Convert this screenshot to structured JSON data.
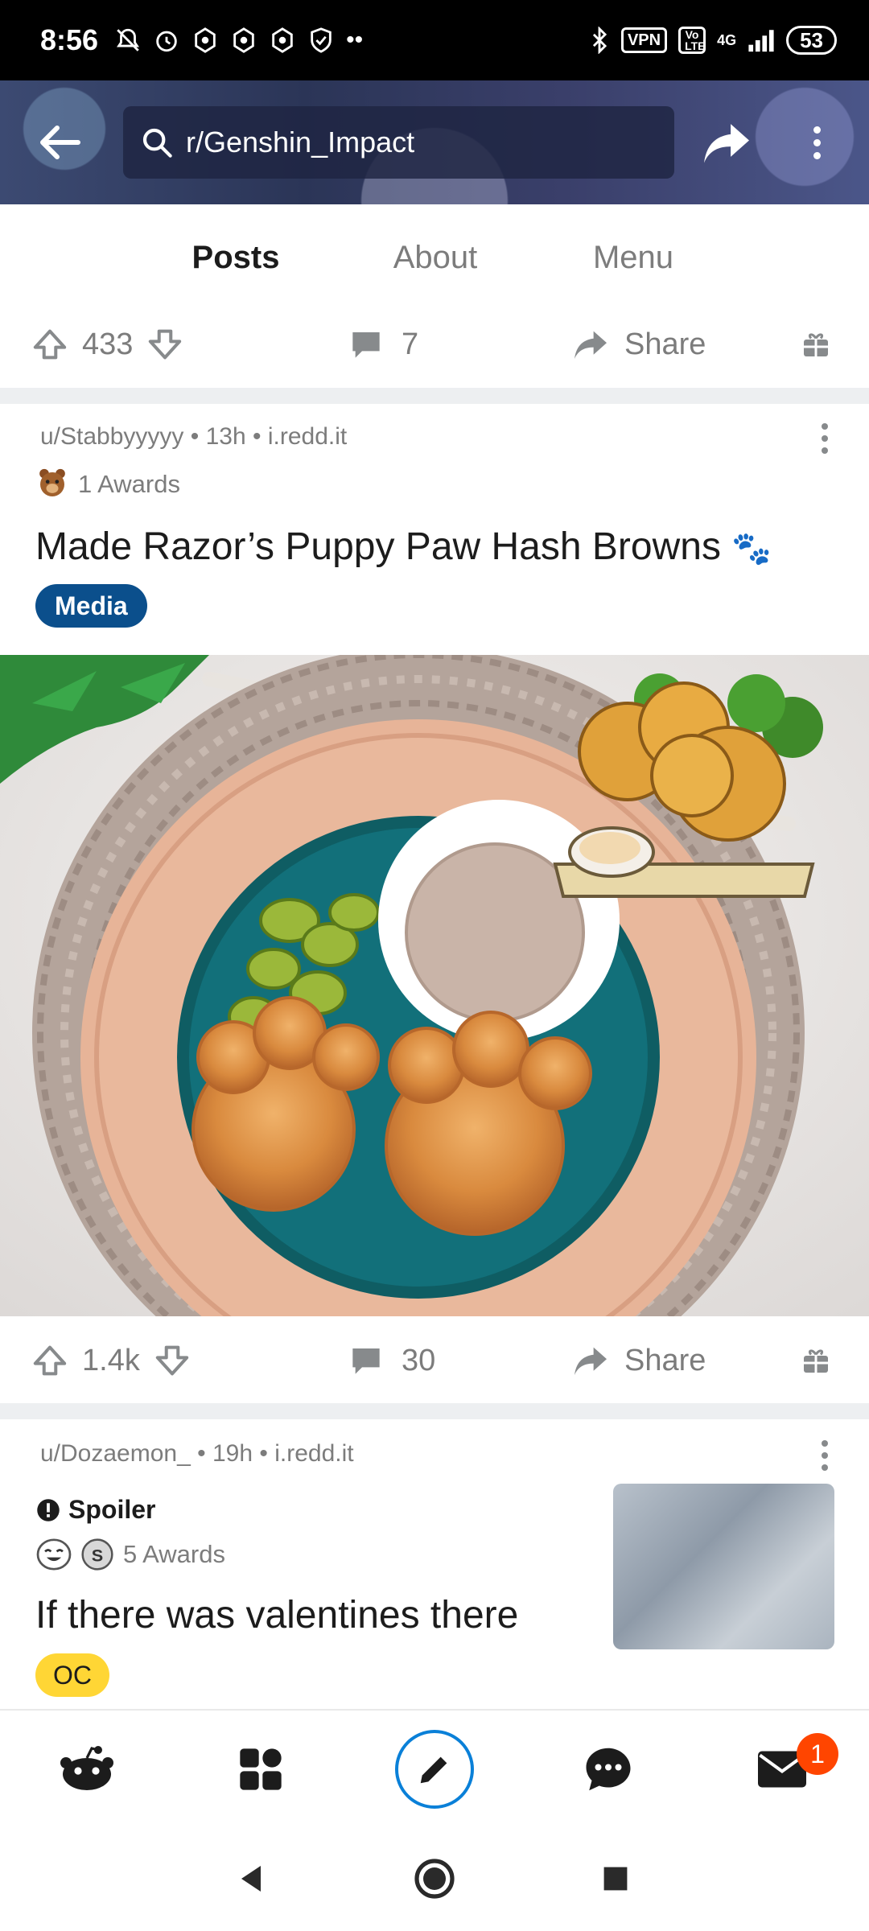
{
  "status_bar": {
    "time": "8:56",
    "network": "4G",
    "vpn_label": "VPN",
    "volte_label": "Vo LTE",
    "battery": "53"
  },
  "header": {
    "search_text": "r/Genshin_Impact"
  },
  "tabs": [
    {
      "label": "Posts",
      "active": true
    },
    {
      "label": "About",
      "active": false
    },
    {
      "label": "Menu",
      "active": false
    }
  ],
  "prev_post_actions": {
    "votes": "433",
    "comments": "7",
    "share_label": "Share"
  },
  "post1": {
    "author": "u/Stabbyyyyy",
    "age": "13h",
    "domain": "i.redd.it",
    "awards": "1 Awards",
    "title": "Made Razor’s Puppy Paw Hash Browns",
    "title_emoji": "🐾",
    "flair": "Media",
    "votes": "1.4k",
    "comments": "30",
    "share_label": "Share"
  },
  "post2": {
    "author": "u/Dozaemon_",
    "age": "19h",
    "domain": "i.redd.it",
    "spoiler_label": "Spoiler",
    "awards": "5 Awards",
    "title": "If there was valentines there",
    "flair": "OC"
  },
  "bottom_nav": {
    "inbox_badge": "1"
  },
  "colors": {
    "accent_blue": "#0a66c8",
    "media_flair": "#0b4f8c",
    "oc_flair": "#ffd635",
    "badge": "#ff4500"
  }
}
